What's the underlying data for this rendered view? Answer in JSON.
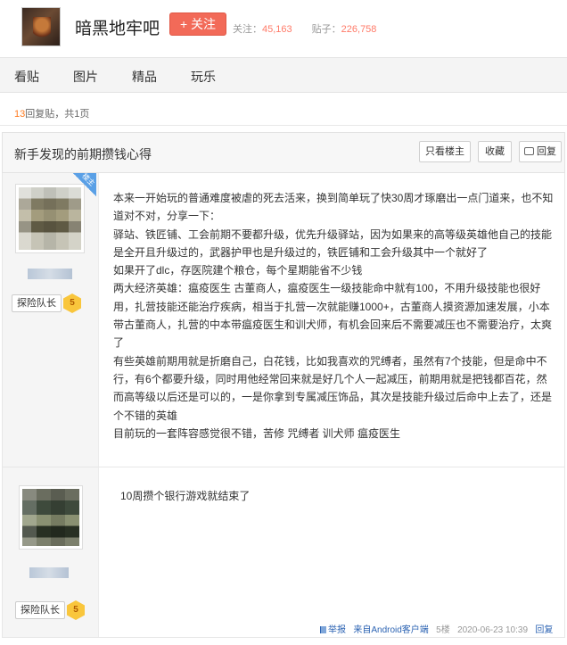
{
  "forum": {
    "name": "暗黑地牢吧",
    "follow_label": "+ 关注",
    "follow_count_label": "关注：",
    "follow_count": "45,163",
    "posts_label": "贴子：",
    "posts_count": "226,758"
  },
  "nav": {
    "tabs": [
      "看贴",
      "图片",
      "精品",
      "玩乐"
    ]
  },
  "pager": {
    "reply_count": "13",
    "suffix": "回复贴，共1页"
  },
  "thread": {
    "title": "新手发现的前期攒钱心得",
    "only_op_label": "只看楼主",
    "favorite_label": "收藏",
    "reply_label": "回复"
  },
  "posts": [
    {
      "op_badge": "楼主",
      "rank_label": "探险队长",
      "level": "5",
      "lines": [
        "本来一开始玩的普通难度被虐的死去活来，换到简单玩了快30周才琢磨出一点门道来，也不知道对不对，分享一下：",
        "驿站、铁匠铺、工会前期不要都升级，优先升级驿站，因为如果来的高等级英雄他自己的技能是全开且升级过的，武器护甲也是升级过的，铁匠铺和工会升级其中一个就好了",
        "如果开了dlc，存医院建个粮仓，每个星期能省不少钱",
        "两大经济英雄：瘟疫医生 古董商人，瘟疫医生一级技能命中就有100，不用升级技能也很好用，扎营技能还能治疗疾病，相当于扎营一次就能赚1000+，古董商人摸资源加速发展，小本带古董商人，扎营的中本带瘟疫医生和训犬师，有机会回来后不需要减压也不需要治疗，太爽了",
        "有些英雄前期用就是折磨自己，白花钱，比如我喜欢的咒缚者，虽然有7个技能，但是命中不行，有6个都要升级，同时用他经常回来就是好几个人一起减压，前期用就是把钱都百花，然而高等级以后还是可以的，一是你拿到专属减压饰品，其次是技能升级过后命中上去了，还是个不错的英雄",
        "目前玩的一套阵容感觉很不错，苦修 咒缚者 训犬师 瘟疫医生"
      ]
    },
    {
      "rank_label": "探险队长",
      "level": "5",
      "lines": [
        "10周攒个银行游戏就结束了"
      ],
      "footer": {
        "report": "举报",
        "client": "来自Android客户端",
        "floor": "5楼",
        "time": "2020-06-23 10:39",
        "reply": "回复"
      }
    }
  ]
}
